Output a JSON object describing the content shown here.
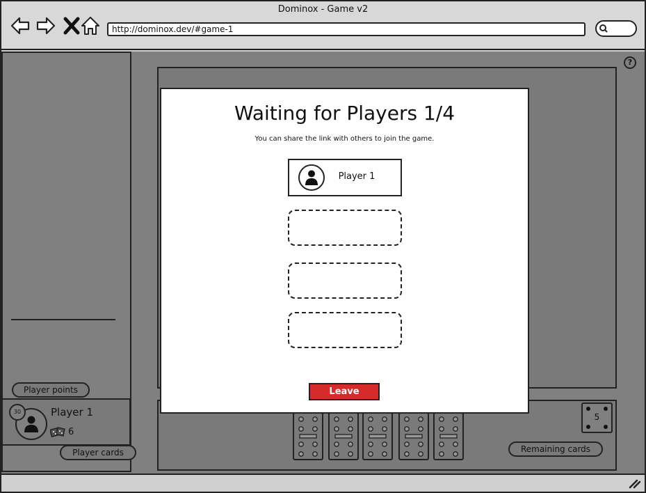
{
  "window": {
    "title": "Dominox - Game v2"
  },
  "browser": {
    "url": "http://dominox.dev/#game-1",
    "nav_icons": [
      "back-arrow-icon",
      "forward-arrow-icon",
      "close-x-icon",
      "home-icon"
    ],
    "search_icon": "search-icon"
  },
  "help_icon": {
    "glyph": "?",
    "name": "help-icon"
  },
  "modal": {
    "title": "Waiting for Players 1/4",
    "subtitle": "You can share the link with others to join the game.",
    "slots": [
      {
        "filled": true,
        "player_name": "Player 1"
      },
      {
        "filled": false
      },
      {
        "filled": false
      },
      {
        "filled": false
      }
    ],
    "leave_label": "Leave",
    "leave_color": "#d62b2b"
  },
  "player": {
    "name": "Player 1",
    "points": "30",
    "cards": "6"
  },
  "callouts": {
    "points": "Player points",
    "cards": "Player cards",
    "remaining": "Remaining cards"
  },
  "deck": {
    "remaining": "5"
  },
  "hand": {
    "domino_count": 5
  }
}
